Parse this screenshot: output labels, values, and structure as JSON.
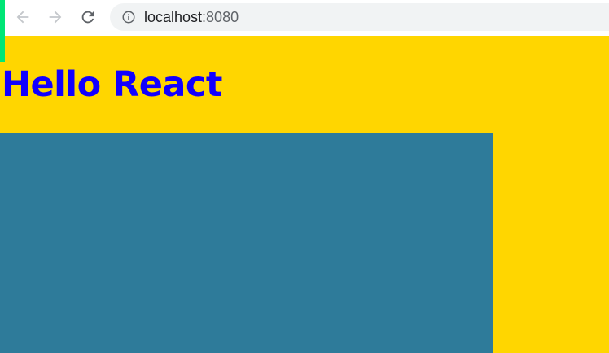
{
  "browser": {
    "url_host": "localhost",
    "url_port": ":8080",
    "icons": {
      "back": "arrow-left-icon",
      "forward": "arrow-right-icon",
      "reload": "reload-icon",
      "info": "info-icon"
    }
  },
  "page": {
    "heading": "Hello React"
  },
  "colors": {
    "page_background": "#ffd600",
    "heading_text": "#1200ff",
    "box_fill": "#2e7b9a",
    "accent_edge": "#00e676"
  }
}
